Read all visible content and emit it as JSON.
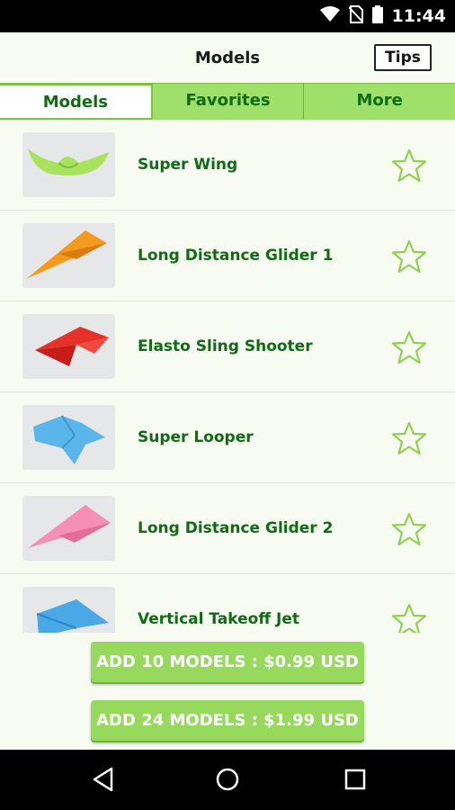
{
  "status_bar": {
    "time": "11:44",
    "icons": [
      "wifi-icon",
      "no-sim-icon",
      "battery-icon"
    ]
  },
  "app_bar": {
    "title": "Models",
    "tips_label": "Tips"
  },
  "tabs": [
    {
      "label": "Models",
      "active": true
    },
    {
      "label": "Favorites",
      "active": false
    },
    {
      "label": "More",
      "active": false
    }
  ],
  "models": [
    {
      "name": "Super Wing",
      "favorite": false,
      "plane_color": "#a7e35c"
    },
    {
      "name": "Long Distance Glider 1",
      "favorite": false,
      "plane_color": "#f59a1e"
    },
    {
      "name": "Elasto Sling Shooter",
      "favorite": false,
      "plane_color": "#e8302a"
    },
    {
      "name": "Super Looper",
      "favorite": false,
      "plane_color": "#5ab6ea"
    },
    {
      "name": "Long Distance Glider 2",
      "favorite": false,
      "plane_color": "#f58fb5"
    },
    {
      "name": "Vertical Takeoff Jet",
      "favorite": false,
      "plane_color": "#4aa8e6"
    }
  ],
  "purchase": {
    "add_10_label": "ADD 10 MODELS : $0.99 USD",
    "add_24_label": "ADD 24 MODELS : $1.99 USD"
  },
  "nav_bar": {
    "icons": [
      "back-icon",
      "home-icon",
      "recents-icon"
    ]
  },
  "colors": {
    "accent_green": "#9ee06a",
    "text_green": "#0f6b14",
    "star_outline": "#8ed14f",
    "background": "#f7fbf1"
  }
}
